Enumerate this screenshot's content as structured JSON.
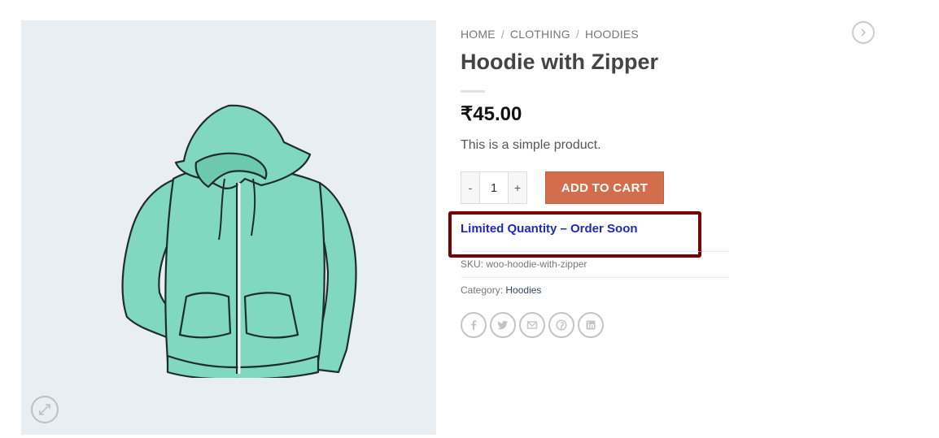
{
  "breadcrumb": {
    "home": "HOME",
    "clothing": "CLOTHING",
    "hoodies": "HOODIES",
    "separator": "/"
  },
  "product": {
    "title": "Hoodie with Zipper",
    "price": "₹45.00",
    "description": "This is a simple product.",
    "quantity": "1",
    "qty_minus": "-",
    "qty_plus": "+",
    "add_to_cart": "ADD TO CART",
    "notice": "Limited Quantity – Order Soon",
    "sku_label": "SKU:",
    "sku_value": "woo-hoodie-with-zipper",
    "category_label": "Category:",
    "category_value": "Hoodies"
  },
  "share_icons": [
    "facebook-icon",
    "twitter-icon",
    "email-icon",
    "pinterest-icon",
    "linkedin-icon"
  ],
  "colors": {
    "accent": "#d26e4b",
    "notice_text": "#1f2ab8",
    "highlight_border": "#7a0000",
    "image_background": "#e9eef3",
    "hoodie": "#7fd8bf"
  }
}
